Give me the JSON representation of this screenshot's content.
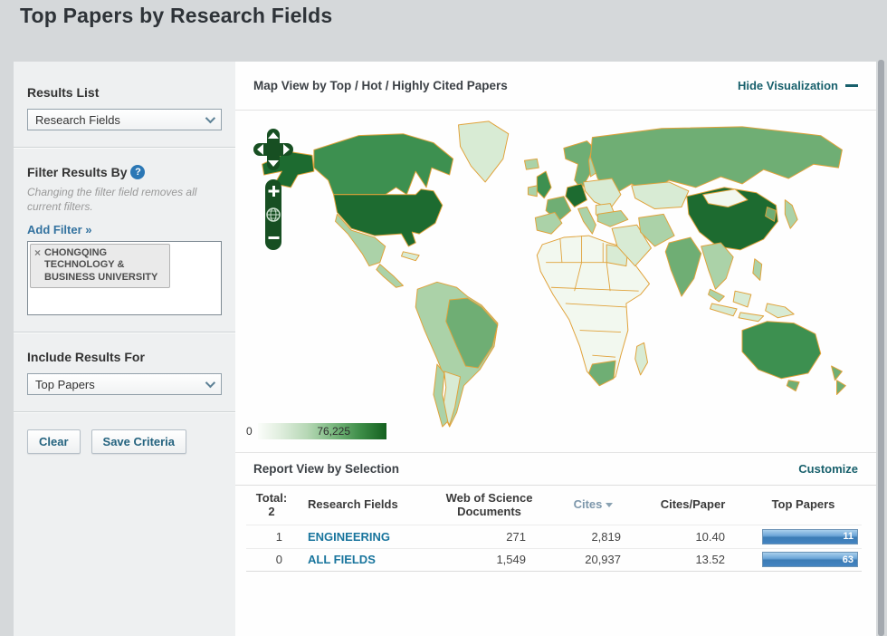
{
  "page": {
    "title": "Top Papers by Research Fields"
  },
  "sidebar": {
    "results_list_label": "Results List",
    "results_list_value": "Research Fields",
    "filter_heading": "Filter Results By",
    "filter_help": "?",
    "filter_note": "Changing the filter field removes all current filters.",
    "add_filter_label": "Add Filter »",
    "filter_tag": {
      "remove": "×",
      "label": "CHONGQING TECHNOLOGY & BUSINESS UNIVERSITY"
    },
    "include_label": "Include Results For",
    "include_value": "Top Papers",
    "clear_label": "Clear",
    "save_label": "Save Criteria"
  },
  "viz": {
    "title": "Map View by Top / Hot / Highly Cited Papers",
    "hide_label": "Hide Visualization",
    "legend_min": "0",
    "legend_max": "76,225",
    "map_colors": {
      "level0": "#f2f8ef",
      "level1": "#d8ebd4",
      "level2": "#abd2a8",
      "level3": "#6fae74",
      "level4": "#3d9050",
      "level5": "#1d6b30"
    },
    "map_countries": {
      "alaska": "level5",
      "canada": "level4",
      "usa": "level5",
      "mexico": "level2",
      "camerica": "level2",
      "cuba": "level1",
      "greenland": "level1",
      "iceland": "level2",
      "samerica": "level2",
      "brazil": "level3",
      "argentina": "level1",
      "chile": "level2",
      "uk": "level4",
      "ireland": "level2",
      "norway_sweden": "level3",
      "finland": "level2",
      "europe_east": "level1",
      "germany": "level5",
      "france": "level3",
      "iberia": "level2",
      "italy": "level2",
      "balkans": "level1",
      "russia": "level3",
      "kazakh": "level1",
      "turkey": "level2",
      "mideast": "level1",
      "iran": "level2",
      "india": "level3",
      "china": "level5",
      "mongolia": "level0",
      "korea": "level3",
      "japan": "level2",
      "seasia": "level2",
      "malay": "level2",
      "borneo": "level1",
      "indo1": "level1",
      "indo2": "level1",
      "png": "level1",
      "philippines": "level2",
      "australia": "level4",
      "tasmania": "level3",
      "nz1": "level3",
      "nz2": "level3",
      "madagascar": "level1",
      "africa": "level0",
      "south_africa": "level3",
      "egypt": "level1"
    }
  },
  "report": {
    "title": "Report View by Selection",
    "customize_label": "Customize",
    "total_label": "Total:",
    "total_value": "2",
    "columns": {
      "fields": "Research Fields",
      "docs": "Web of Science Documents",
      "cites": "Cites",
      "cpp": "Cites/Paper",
      "top": "Top Papers"
    },
    "rows": [
      {
        "rank": "1",
        "field": "ENGINEERING",
        "docs": "271",
        "cites": "2,819",
        "cpp": "10.40",
        "top": "11",
        "bar_pct": 100
      },
      {
        "rank": "0",
        "field": "ALL FIELDS",
        "docs": "1,549",
        "cites": "20,937",
        "cpp": "13.52",
        "top": "63",
        "bar_pct": 100
      }
    ]
  }
}
